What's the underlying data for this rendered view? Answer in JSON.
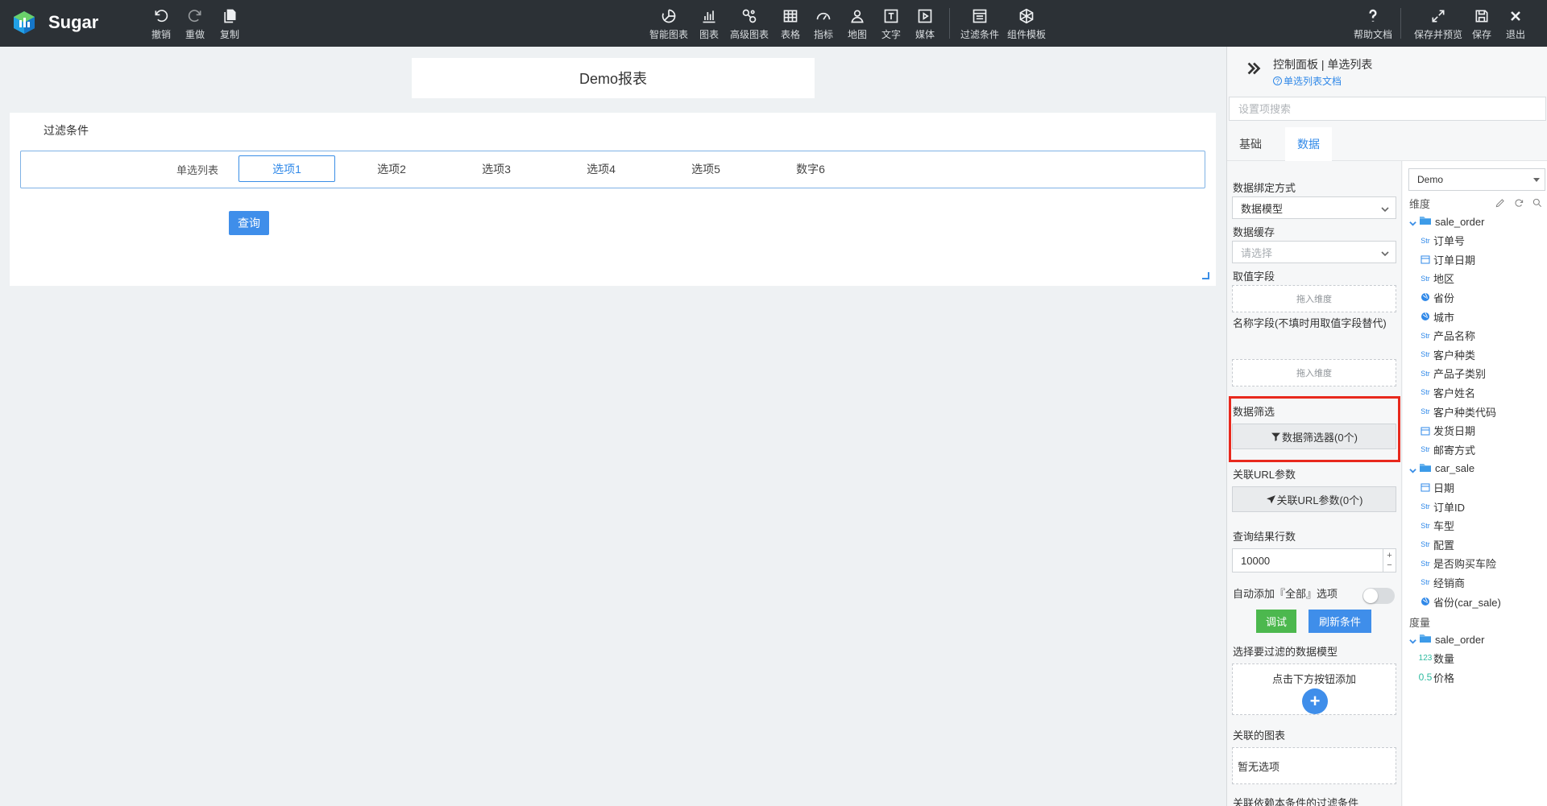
{
  "app": {
    "name": "Sugar"
  },
  "toolbar": {
    "left": [
      {
        "id": "undo",
        "label": "撤销",
        "icon": "undo-icon"
      },
      {
        "id": "redo",
        "label": "重做",
        "icon": "redo-icon"
      },
      {
        "id": "copy",
        "label": "复制",
        "icon": "copy-icon"
      }
    ],
    "center": [
      {
        "id": "smart-chart",
        "label": "智能图表",
        "icon": "smart-chart-icon"
      },
      {
        "id": "chart",
        "label": "图表",
        "icon": "bar-chart-icon"
      },
      {
        "id": "advanced-chart",
        "label": "高级图表",
        "icon": "advanced-chart-icon"
      },
      {
        "id": "table",
        "label": "表格",
        "icon": "table-icon"
      },
      {
        "id": "indicator",
        "label": "指标",
        "icon": "gauge-icon"
      },
      {
        "id": "map",
        "label": "地图",
        "icon": "map-pin-icon"
      },
      {
        "id": "text",
        "label": "文字",
        "icon": "text-icon"
      },
      {
        "id": "media",
        "label": "媒体",
        "icon": "media-icon"
      },
      {
        "id": "filter",
        "label": "过滤条件",
        "icon": "filter-form-icon"
      },
      {
        "id": "template",
        "label": "组件模板",
        "icon": "template-icon"
      }
    ],
    "right": [
      {
        "id": "help",
        "label": "帮助文档",
        "icon": "help-icon"
      },
      {
        "id": "save-preview",
        "label": "保存并预览",
        "icon": "expand-icon"
      },
      {
        "id": "save",
        "label": "保存",
        "icon": "save-icon"
      },
      {
        "id": "exit",
        "label": "退出",
        "icon": "close-icon"
      }
    ]
  },
  "canvas": {
    "report_title": "Demo报表",
    "filter_title": "过滤条件",
    "radio_label": "单选列表",
    "options": [
      "选项1",
      "选项2",
      "选项3",
      "选项4",
      "选项5",
      "数字6"
    ],
    "selected_option": "选项1",
    "query_button": "查询"
  },
  "panel": {
    "path": "控制面板 | 单选列表",
    "doc_link": "单选列表文档",
    "search_placeholder": "设置项搜索",
    "tabs": [
      "基础",
      "数据"
    ],
    "active_tab": "数据",
    "config": {
      "binding_label": "数据绑定方式",
      "binding_value": "数据模型",
      "cache_label": "数据缓存",
      "cache_placeholder": "请选择",
      "value_field_label": "取值字段",
      "value_field_drop": "拖入维度",
      "name_field_label": "名称字段(不填时用取值字段替代)",
      "name_field_drop": "拖入维度",
      "data_filter_label": "数据筛选",
      "data_filter_button": "数据筛选器(0个)",
      "url_param_label": "关联URL参数",
      "url_param_button": "关联URL参数(0个)",
      "rows_label": "查询结果行数",
      "rows_value": "10000",
      "auto_all_label": "自动添加『全部』选项",
      "auto_all_enabled": false,
      "debug_button": "调试",
      "refresh_button": "刷新条件",
      "filter_model_label": "选择要过滤的数据模型",
      "filter_model_hint": "点击下方按钮添加",
      "linked_chart_label": "关联的图表",
      "linked_chart_empty": "暂无选项",
      "depends_label": "关联依赖本条件的过滤条件"
    },
    "fields": {
      "datasource": "Demo",
      "dimension_header": "维度",
      "measure_header": "度量",
      "dimension_groups": [
        {
          "name": "sale_order",
          "items": [
            {
              "type": "Str",
              "name": "订单号"
            },
            {
              "type": "date",
              "name": "订单日期"
            },
            {
              "type": "Str",
              "name": "地区"
            },
            {
              "type": "geo",
              "name": "省份"
            },
            {
              "type": "geo",
              "name": "城市"
            },
            {
              "type": "Str",
              "name": "产品名称"
            },
            {
              "type": "Str",
              "name": "客户种类"
            },
            {
              "type": "Str",
              "name": "产品子类别"
            },
            {
              "type": "Str",
              "name": "客户姓名"
            },
            {
              "type": "Str",
              "name": "客户种类代码"
            },
            {
              "type": "date",
              "name": "发货日期"
            },
            {
              "type": "Str",
              "name": "邮寄方式"
            }
          ]
        },
        {
          "name": "car_sale",
          "items": [
            {
              "type": "date",
              "name": "日期"
            },
            {
              "type": "Str",
              "name": "订单ID"
            },
            {
              "type": "Str",
              "name": "车型"
            },
            {
              "type": "Str",
              "name": "配置"
            },
            {
              "type": "Str",
              "name": "是否购买车险"
            },
            {
              "type": "Str",
              "name": "经销商"
            },
            {
              "type": "geo",
              "name": "省份(car_sale)"
            }
          ]
        }
      ],
      "measure_groups": [
        {
          "name": "sale_order",
          "items": [
            {
              "type": "123",
              "name": "数量"
            },
            {
              "type": "0.5",
              "name": "价格"
            }
          ]
        }
      ]
    }
  },
  "colors": {
    "toolbar_bg": "#2c3136",
    "accent_blue": "#3f8eea",
    "green": "#4cb84e",
    "highlight_red": "#e8291d"
  }
}
